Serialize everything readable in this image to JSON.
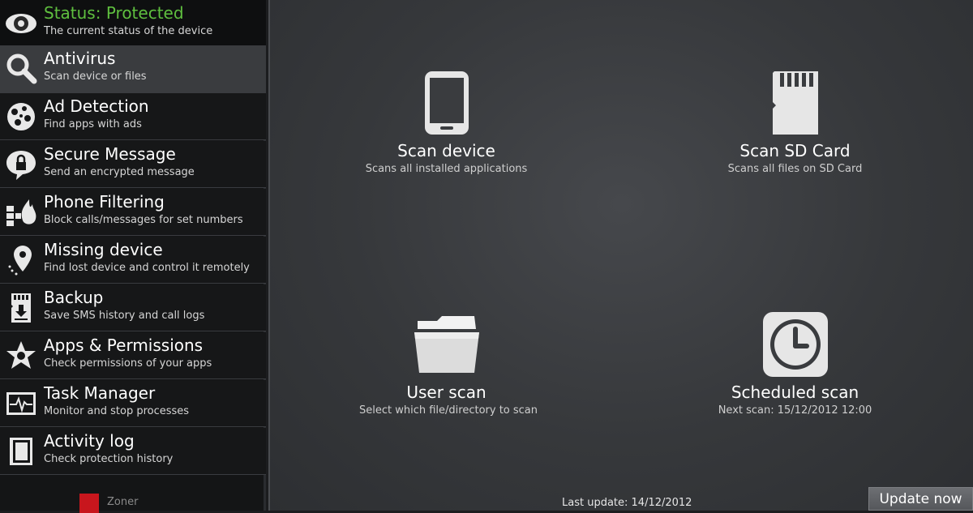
{
  "sidebar": {
    "items": [
      {
        "title": "Status: Protected",
        "subtitle": "The current status of the device",
        "icon": "eye-icon"
      },
      {
        "title": "Antivirus",
        "subtitle": "Scan device or files",
        "icon": "magnifier-icon"
      },
      {
        "title": "Ad Detection",
        "subtitle": "Find apps with ads",
        "icon": "ad-cluster-icon"
      },
      {
        "title": "Secure Message",
        "subtitle": "Send an encrypted message",
        "icon": "lock-bubble-icon"
      },
      {
        "title": "Phone Filtering",
        "subtitle": "Block calls/messages for set numbers",
        "icon": "firewall-icon"
      },
      {
        "title": "Missing device",
        "subtitle": "Find lost device and control it remotely",
        "icon": "location-pin-icon"
      },
      {
        "title": "Backup",
        "subtitle": "Save SMS history and call logs",
        "icon": "sd-download-icon"
      },
      {
        "title": "Apps & Permissions",
        "subtitle": "Check permissions of your apps",
        "icon": "sheriff-star-icon"
      },
      {
        "title": "Task Manager",
        "subtitle": "Monitor and stop processes",
        "icon": "pulse-monitor-icon"
      },
      {
        "title": "Activity log",
        "subtitle": "Check protection history",
        "icon": "log-book-icon"
      }
    ],
    "logo_text": "Zoner"
  },
  "main": {
    "tiles": [
      {
        "label": "Scan device",
        "subtitle": "Scans all installed applications",
        "icon": "phone-icon"
      },
      {
        "label": "Scan SD Card",
        "subtitle": "Scans all files on SD Card",
        "icon": "sd-card-icon"
      },
      {
        "label": "User scan",
        "subtitle": "Select which file/directory to scan",
        "icon": "folder-icon"
      },
      {
        "label": "Scheduled scan",
        "subtitle": "Next scan: 15/12/2012 12:00",
        "icon": "clock-icon"
      }
    ],
    "last_update": "Last update: 14/12/2012",
    "update_button": "Update now"
  },
  "colors": {
    "status_green": "#5fbf3f",
    "sidebar_bg": "#161718",
    "selected_bg": "#3a3c3f",
    "brand_red": "#c8161d"
  }
}
